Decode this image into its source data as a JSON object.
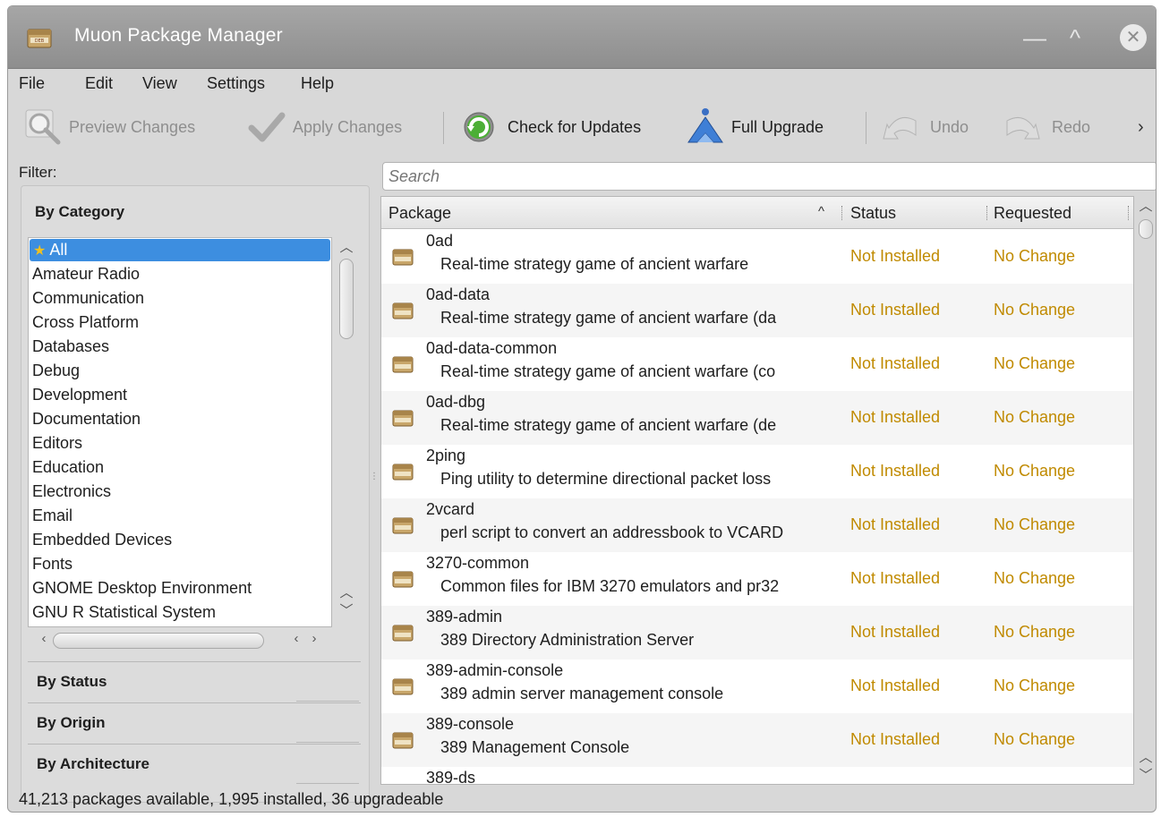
{
  "window": {
    "title": "Muon Package Manager",
    "minimize_glyph": "—",
    "maximize_glyph": "^",
    "close_glyph": "✕"
  },
  "menu": [
    "File",
    "Edit",
    "View",
    "Settings",
    "Help"
  ],
  "toolbar": {
    "preview_changes": "Preview Changes",
    "apply_changes": "Apply Changes",
    "check_for_updates": "Check for Updates",
    "full_upgrade": "Full Upgrade",
    "undo": "Undo",
    "redo": "Redo",
    "overflow": "›"
  },
  "filter": {
    "label": "Filter:",
    "by_category": "By Category",
    "categories": [
      "All",
      "Amateur Radio",
      "Communication",
      "Cross Platform",
      "Databases",
      "Debug",
      "Development",
      "Documentation",
      "Editors",
      "Education",
      "Electronics",
      "Email",
      "Embedded Devices",
      "Fonts",
      "GNOME Desktop Environment",
      "GNU R Statistical System"
    ],
    "selected_index": 0,
    "by_status": "By Status",
    "by_origin": "By Origin",
    "by_architecture": "By Architecture"
  },
  "search": {
    "placeholder": "Search"
  },
  "table": {
    "columns": {
      "package": "Package",
      "status": "Status",
      "requested": "Requested"
    },
    "rows": [
      {
        "name": "0ad",
        "desc": "Real-time strategy game of ancient warfare",
        "status": "Not Installed",
        "requested": "No Change"
      },
      {
        "name": "0ad-data",
        "desc": "Real-time strategy game of ancient warfare (da",
        "status": "Not Installed",
        "requested": "No Change"
      },
      {
        "name": "0ad-data-common",
        "desc": "Real-time strategy game of ancient warfare (co",
        "status": "Not Installed",
        "requested": "No Change"
      },
      {
        "name": "0ad-dbg",
        "desc": "Real-time strategy game of ancient warfare (de",
        "status": "Not Installed",
        "requested": "No Change"
      },
      {
        "name": "2ping",
        "desc": "Ping utility to determine directional packet loss",
        "status": "Not Installed",
        "requested": "No Change"
      },
      {
        "name": "2vcard",
        "desc": "perl script to convert an addressbook to VCARD",
        "status": "Not Installed",
        "requested": "No Change"
      },
      {
        "name": "3270-common",
        "desc": "Common files for IBM 3270 emulators and pr32",
        "status": "Not Installed",
        "requested": "No Change"
      },
      {
        "name": "389-admin",
        "desc": "389 Directory Administration Server",
        "status": "Not Installed",
        "requested": "No Change"
      },
      {
        "name": "389-admin-console",
        "desc": "389 admin server management console",
        "status": "Not Installed",
        "requested": "No Change"
      },
      {
        "name": "389-console",
        "desc": "389 Management Console",
        "status": "Not Installed",
        "requested": "No Change"
      },
      {
        "name": "389-ds",
        "desc": "",
        "status": "",
        "requested": ""
      }
    ]
  },
  "statusbar": "41,213 packages available, 1,995 installed, 36 upgradeable",
  "colors": {
    "accent": "#3d8ee0",
    "status_text": "#c08a00",
    "titlebar": "#999999"
  },
  "icons": [
    "deb-package-icon",
    "preview-magnifier-icon",
    "checkmark-icon",
    "refresh-icon",
    "upgrade-arrow-icon",
    "undo-icon",
    "redo-icon",
    "star-icon"
  ]
}
